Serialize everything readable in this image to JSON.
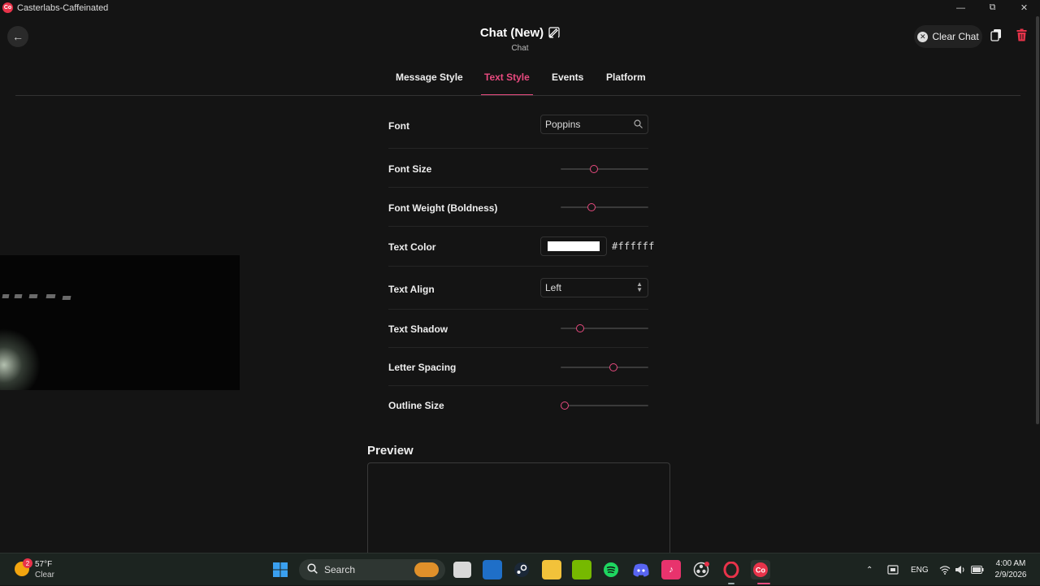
{
  "window": {
    "title": "Casterlabs-Caffeinated",
    "app_icon_text": "Co"
  },
  "header": {
    "title": "Chat (New)",
    "subtitle": "Chat",
    "clear_chat_label": "Clear Chat"
  },
  "tabs": [
    {
      "label": "Message Style",
      "active": false
    },
    {
      "label": "Text Style",
      "active": true
    },
    {
      "label": "Events",
      "active": false
    },
    {
      "label": "Platform",
      "active": false
    }
  ],
  "settings": {
    "font": {
      "label": "Font",
      "value": "Poppins"
    },
    "font_size": {
      "label": "Font Size",
      "level": 0.38
    },
    "font_weight": {
      "label": "Font Weight (Boldness)",
      "level": 0.35
    },
    "text_color": {
      "label": "Text Color",
      "hex": "#ffffff"
    },
    "text_align": {
      "label": "Text Align",
      "value": "Left"
    },
    "text_shadow": {
      "label": "Text Shadow",
      "level": 0.22
    },
    "letter_spacing": {
      "label": "Letter Spacing",
      "level": 0.6
    },
    "outline_size": {
      "label": "Outline Size",
      "level": 0.05
    }
  },
  "preview": {
    "title": "Preview"
  },
  "colors": {
    "accent": "#e84a7f",
    "background": "#141414",
    "delete": "#e8334a"
  },
  "taskbar": {
    "weather": {
      "temp": "57°F",
      "condition": "Clear",
      "badge": "2"
    },
    "search_label": "Search",
    "language": "ENG",
    "time": "4:00 AM",
    "date": "2/9/2026"
  }
}
